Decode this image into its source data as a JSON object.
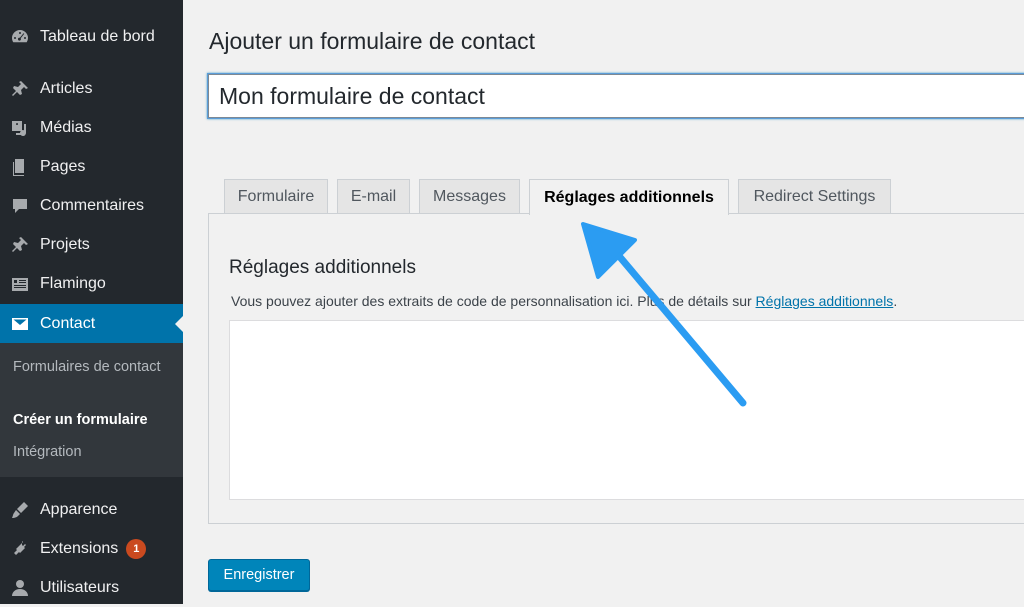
{
  "sidebar": {
    "items": [
      {
        "label": "Tableau de bord",
        "icon": "dashboard-icon"
      },
      {
        "label": "Articles",
        "icon": "pin-icon"
      },
      {
        "label": "Médias",
        "icon": "media-icon"
      },
      {
        "label": "Pages",
        "icon": "page-icon"
      },
      {
        "label": "Commentaires",
        "icon": "comment-icon"
      },
      {
        "label": "Projets",
        "icon": "pin-icon"
      },
      {
        "label": "Flamingo",
        "icon": "inbox-icon"
      },
      {
        "label": "Contact",
        "icon": "mail-icon"
      },
      {
        "label": "Apparence",
        "icon": "brush-icon"
      },
      {
        "label": "Extensions",
        "icon": "plugin-icon",
        "badge": "1"
      },
      {
        "label": "Utilisateurs",
        "icon": "user-icon"
      }
    ],
    "submenu": [
      {
        "label": "Formulaires de contact"
      },
      {
        "label": "Créer un formulaire"
      },
      {
        "label": "Intégration"
      }
    ]
  },
  "main": {
    "page_title": "Ajouter un formulaire de contact",
    "form_title_value": "Mon formulaire de contact",
    "tabs": [
      {
        "label": "Formulaire"
      },
      {
        "label": "E-mail"
      },
      {
        "label": "Messages"
      },
      {
        "label": "Réglages additionnels"
      },
      {
        "label": "Redirect Settings"
      }
    ],
    "panel": {
      "heading": "Réglages additionnels",
      "description": "Vous pouvez ajouter des extraits de code de personnalisation ici. Plus de détails sur ",
      "link_text": "Réglages additionnels",
      "description_end": "."
    },
    "save_label": "Enregistrer"
  },
  "colors": {
    "sidebar_bg": "#23282d",
    "accent": "#0073aa",
    "button": "#0085ba",
    "badge": "#ca4a1f",
    "annotation_arrow": "#2b9cf2"
  }
}
